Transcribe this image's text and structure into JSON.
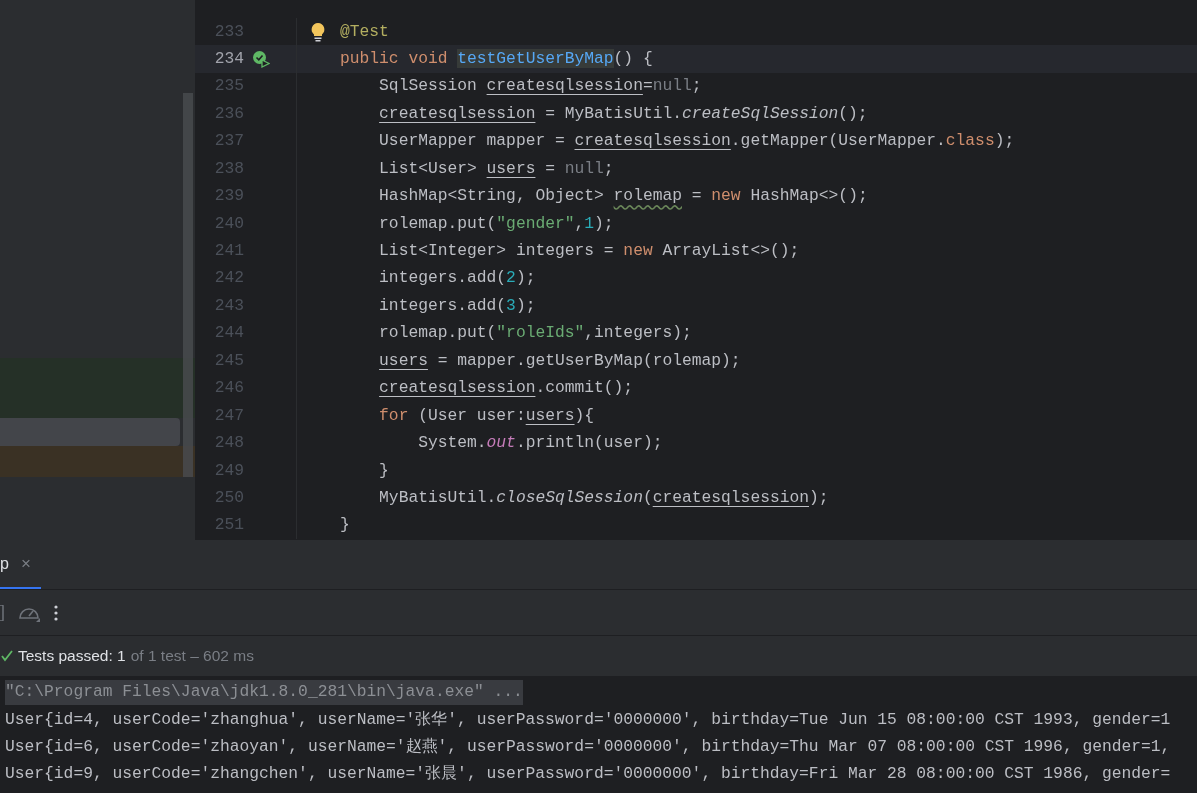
{
  "editor": {
    "lines": [
      {
        "number": "233",
        "current": false,
        "kind": "hint",
        "tokens": [
          {
            "kind": "annotation",
            "text": "@Test"
          }
        ]
      },
      {
        "number": "234",
        "current": true,
        "kind": "test",
        "tokens": [
          {
            "kind": "keyword",
            "text": "public void "
          },
          {
            "kind": "declaration",
            "text": "testGetUserByMap"
          },
          {
            "kind": "plain",
            "text": "() {"
          }
        ]
      },
      {
        "number": "235",
        "current": false,
        "tokens": [
          {
            "kind": "plain",
            "text": "    SqlSession "
          },
          {
            "kind": "variable",
            "text": "createsqlsession"
          },
          {
            "kind": "plain",
            "text": "="
          },
          {
            "kind": "null",
            "text": "null"
          },
          {
            "kind": "plain",
            "text": ";"
          }
        ]
      },
      {
        "number": "236",
        "current": false,
        "tokens": [
          {
            "kind": "variable",
            "text": "    createsqlsession"
          },
          {
            "kind": "plain",
            "text": " = MyBatisUtil."
          },
          {
            "kind": "static",
            "text": "createSqlSession"
          },
          {
            "kind": "plain",
            "text": "();"
          }
        ]
      },
      {
        "number": "237",
        "current": false,
        "tokens": [
          {
            "kind": "plain",
            "text": "    UserMapper mapper = "
          },
          {
            "kind": "variable",
            "text": "createsqlsession"
          },
          {
            "kind": "plain",
            "text": ".getMapper(UserMapper."
          },
          {
            "kind": "keyword",
            "text": "class"
          },
          {
            "kind": "plain",
            "text": ");"
          }
        ]
      },
      {
        "number": "238",
        "current": false,
        "tokens": [
          {
            "kind": "plain",
            "text": "    List<User> "
          },
          {
            "kind": "variable",
            "text": "users"
          },
          {
            "kind": "plain",
            "text": " = "
          },
          {
            "kind": "null",
            "text": "null"
          },
          {
            "kind": "plain",
            "text": ";"
          }
        ]
      },
      {
        "number": "239",
        "current": false,
        "tokens": [
          {
            "kind": "plain",
            "text": "    HashMap<String, Object> "
          },
          {
            "kind": "warning",
            "text": "rolemap"
          },
          {
            "kind": "plain",
            "text": " = "
          },
          {
            "kind": "keyword",
            "text": "new"
          },
          {
            "kind": "plain",
            "text": " HashMap<>();"
          }
        ]
      },
      {
        "number": "240",
        "current": false,
        "tokens": [
          {
            "kind": "plain",
            "text": "    rolemap.put("
          },
          {
            "kind": "string",
            "text": "\"gender\""
          },
          {
            "kind": "plain",
            "text": ","
          },
          {
            "kind": "number",
            "text": "1"
          },
          {
            "kind": "plain",
            "text": ");"
          }
        ]
      },
      {
        "number": "241",
        "current": false,
        "tokens": [
          {
            "kind": "plain",
            "text": "    List<Integer> integers = "
          },
          {
            "kind": "keyword",
            "text": "new"
          },
          {
            "kind": "plain",
            "text": " ArrayList<>();"
          }
        ]
      },
      {
        "number": "242",
        "current": false,
        "tokens": [
          {
            "kind": "plain",
            "text": "    integers.add("
          },
          {
            "kind": "number",
            "text": "2"
          },
          {
            "kind": "plain",
            "text": ");"
          }
        ]
      },
      {
        "number": "243",
        "current": false,
        "tokens": [
          {
            "kind": "plain",
            "text": "    integers.add("
          },
          {
            "kind": "number",
            "text": "3"
          },
          {
            "kind": "plain",
            "text": ");"
          }
        ]
      },
      {
        "number": "244",
        "current": false,
        "tokens": [
          {
            "kind": "plain",
            "text": "    rolemap.put("
          },
          {
            "kind": "string",
            "text": "\"roleIds\""
          },
          {
            "kind": "plain",
            "text": ",integers);"
          }
        ]
      },
      {
        "number": "245",
        "current": false,
        "tokens": [
          {
            "kind": "variable",
            "text": "    users"
          },
          {
            "kind": "plain",
            "text": " = mapper.getUserByMap(rolemap);"
          }
        ]
      },
      {
        "number": "246",
        "current": false,
        "tokens": [
          {
            "kind": "variable",
            "text": "    createsqlsession"
          },
          {
            "kind": "plain",
            "text": ".commit();"
          }
        ]
      },
      {
        "number": "247",
        "current": false,
        "tokens": [
          {
            "kind": "keyword",
            "text": "    for"
          },
          {
            "kind": "plain",
            "text": " (User user:"
          },
          {
            "kind": "variable",
            "text": "users"
          },
          {
            "kind": "plain",
            "text": "){"
          }
        ]
      },
      {
        "number": "248",
        "current": false,
        "tokens": [
          {
            "kind": "plain",
            "text": "        System."
          },
          {
            "kind": "field",
            "text": "out"
          },
          {
            "kind": "plain",
            "text": ".println(user);"
          }
        ]
      },
      {
        "number": "249",
        "current": false,
        "tokens": [
          {
            "kind": "plain",
            "text": "    }"
          }
        ]
      },
      {
        "number": "250",
        "current": false,
        "tokens": [
          {
            "kind": "plain",
            "text": "    MyBatisUtil."
          },
          {
            "kind": "static",
            "text": "closeSqlSession"
          },
          {
            "kind": "plain",
            "text": "("
          },
          {
            "kind": "variable",
            "text": "createsqlsession"
          },
          {
            "kind": "plain",
            "text": ");"
          }
        ]
      },
      {
        "number": "251",
        "current": false,
        "tokens": [
          {
            "kind": "plain",
            "text": "}"
          }
        ]
      }
    ]
  },
  "run_panel": {
    "tabs": [
      {
        "label": "p",
        "close": "×",
        "selected": true
      }
    ],
    "status": {
      "label": "Tests passed:",
      "count": "1",
      "detail": "of 1 test – 602 ms"
    },
    "console": [
      {
        "kind": "command",
        "text": "\"C:\\Program Files\\Java\\jdk1.8.0_281\\bin\\java.exe\" ..."
      },
      {
        "kind": "output",
        "text": "User{id=4, userCode='zhanghua', userName='张华', userPassword='0000000', birthday=Tue Jun 15 08:00:00 CST 1993, gender=1"
      },
      {
        "kind": "output",
        "text": "User{id=6, userCode='zhaoyan', userName='赵燕', userPassword='0000000', birthday=Thu Mar 07 08:00:00 CST 1996, gender=1,"
      },
      {
        "kind": "output",
        "text": "User{id=9, userCode='zhangchen', userName='张晨', userPassword='0000000', birthday=Fri Mar 28 08:00:00 CST 1986, gender="
      }
    ]
  }
}
